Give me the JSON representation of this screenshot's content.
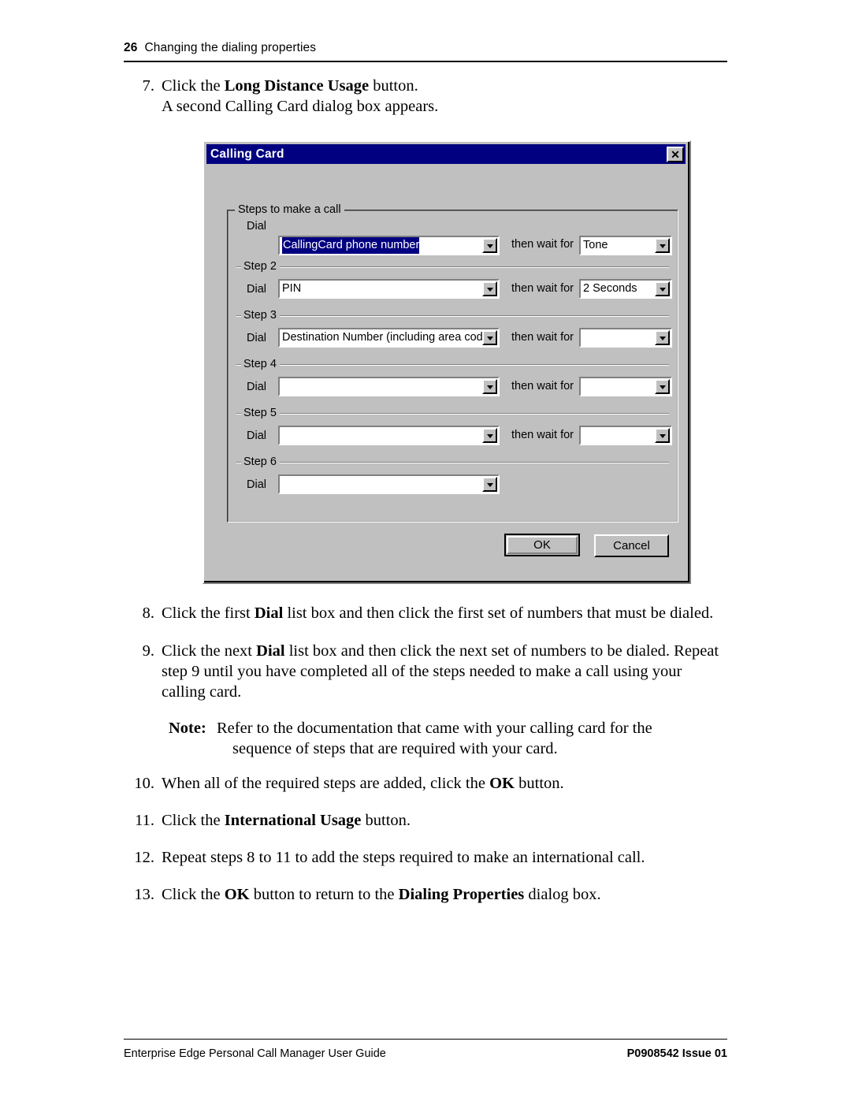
{
  "header": {
    "page_number": "26",
    "chapter_title": "Changing the dialing properties"
  },
  "steps_before": [
    {
      "num": "7.",
      "line1_pre": "Click the ",
      "line1_bold": "Long Distance Usage",
      "line1_post": " button.",
      "line2": "A second Calling Card dialog box appears."
    }
  ],
  "dialog": {
    "title": "Calling Card",
    "close_icon": "close-icon",
    "group_legend": "Steps to make a call",
    "dial_label": "Dial",
    "wait_label": "then wait for",
    "steps": [
      {
        "sep_label": "",
        "dial_value": "CallingCard phone number",
        "dial_selected": true,
        "wait_value": "Tone",
        "has_wait": true
      },
      {
        "sep_label": "Step 2",
        "dial_value": "PIN",
        "dial_selected": false,
        "wait_value": "2 Seconds",
        "has_wait": true
      },
      {
        "sep_label": "Step 3",
        "dial_value": "Destination Number (including area code)",
        "dial_selected": false,
        "wait_value": "",
        "has_wait": true
      },
      {
        "sep_label": "Step 4",
        "dial_value": "",
        "dial_selected": false,
        "wait_value": "",
        "has_wait": true
      },
      {
        "sep_label": "Step 5",
        "dial_value": "",
        "dial_selected": false,
        "wait_value": "",
        "has_wait": true
      },
      {
        "sep_label": "Step 6",
        "dial_value": "",
        "dial_selected": false,
        "wait_value": "",
        "has_wait": false
      }
    ],
    "ok_label": "OK",
    "cancel_label": "Cancel",
    "colors": {
      "titlebar": "#000080",
      "face": "#c0c0c0",
      "selection": "#000080",
      "field": "#ffffff"
    }
  },
  "steps_after": [
    {
      "num": "8.",
      "pre": "Click the first ",
      "bold": "Dial",
      "post": " list box and then click the first set of numbers that must be dialed."
    },
    {
      "num": "9.",
      "pre": "Click the next ",
      "bold": "Dial",
      "post": " list box and then click the next set of numbers to be dialed. Repeat step 9 until you have completed all of the steps needed to make a call using your calling card."
    }
  ],
  "note": {
    "label": "Note:",
    "line1": "Refer to the documentation that came with your calling card for the",
    "line2": "sequence of steps that are required with your card."
  },
  "steps_tail": [
    {
      "num": "10.",
      "pre": "When all of the required steps are added, click the ",
      "bold": "OK",
      "post": " button."
    },
    {
      "num": "11.",
      "pre": "Click the ",
      "bold": "International Usage",
      "post": " button."
    },
    {
      "num": "12.",
      "pre": "Repeat steps 8 to 11 to add the steps required to make an international call.",
      "bold": "",
      "post": ""
    },
    {
      "num": "13.",
      "pre": "Click the ",
      "bold": "OK",
      "mid": " button to return to the ",
      "bold2": "Dialing Properties",
      "post": " dialog box."
    }
  ],
  "footer": {
    "left": "Enterprise Edge Personal Call Manager User Guide",
    "right": "P0908542 Issue 01"
  }
}
